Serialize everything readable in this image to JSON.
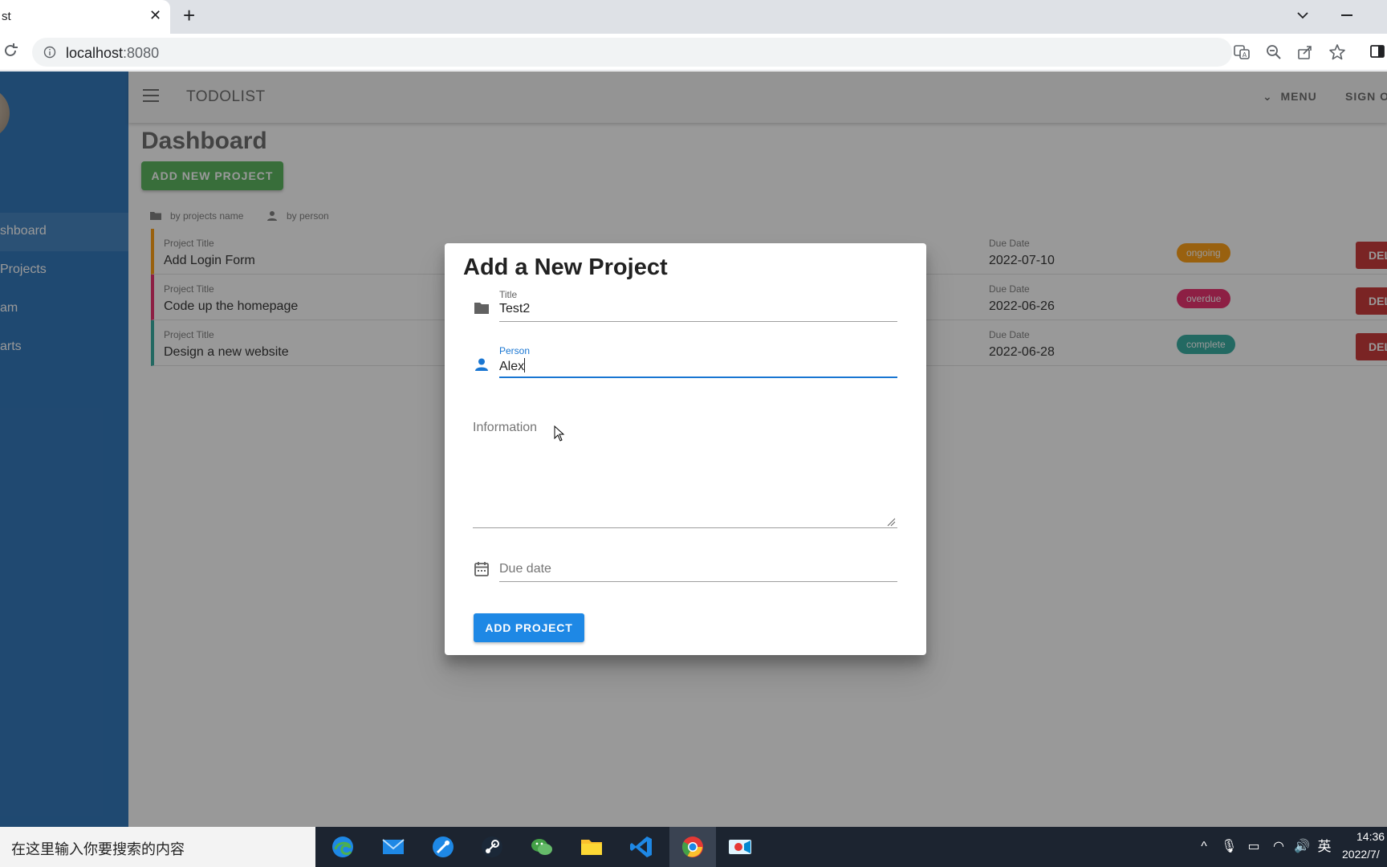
{
  "browser": {
    "tab_title": "st",
    "url_host": "localhost",
    "url_port": ":8080"
  },
  "app": {
    "title": "TODOLIST",
    "menu_label": "MENU",
    "signout_label": "SIGN O"
  },
  "sidebar": {
    "items": [
      {
        "label": "shboard"
      },
      {
        "label": "Projects"
      },
      {
        "label": "am"
      },
      {
        "label": "arts"
      }
    ]
  },
  "dashboard": {
    "title": "Dashboard",
    "add_button": "ADD NEW PROJECT",
    "sort_by_name": "by projects name",
    "sort_by_person": "by person",
    "project_title_label": "Project Title",
    "due_date_label": "Due Date",
    "delete_label": "DEL",
    "projects": [
      {
        "title": "Add Login Form",
        "due": "2022-07-10",
        "status": "ongoing",
        "status_color": "#ff9800"
      },
      {
        "title": "Code up the homepage",
        "due": "2022-06-26",
        "status": "overdue",
        "status_color": "#e91e63"
      },
      {
        "title": "Design a new website",
        "due": "2022-06-28",
        "status": "complete",
        "status_color": "#26a69a"
      }
    ]
  },
  "dialog": {
    "title": "Add a New Project",
    "title_field": {
      "label": "Title",
      "value": "Test2"
    },
    "person_field": {
      "label": "Person",
      "value": "Alex"
    },
    "info_field": {
      "label": "Information",
      "value": ""
    },
    "due_field": {
      "placeholder": "Due date"
    },
    "submit_label": "ADD PROJECT"
  },
  "taskbar": {
    "search_placeholder": "在这里输入你要搜索的内容",
    "ime_indicator": "英",
    "time": "14:36",
    "date": "2022/7/"
  },
  "colors": {
    "sidebar": "#1f6bb5",
    "add_new": "#4caf50",
    "primary": "#1e88e5",
    "delete": "#c62828"
  }
}
